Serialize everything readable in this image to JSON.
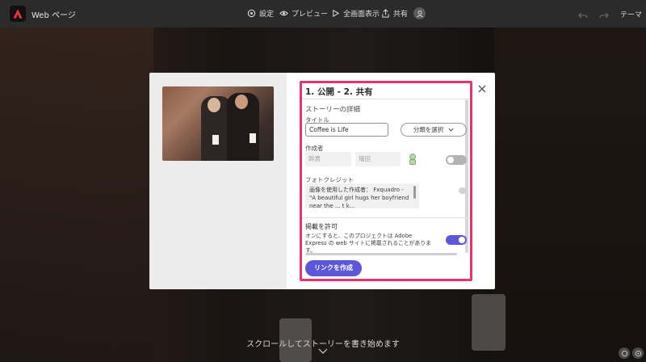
{
  "app": {
    "title": "Web ページ"
  },
  "toolbar": {
    "settings": "設定",
    "preview": "プレビュー",
    "fullscreen": "全画面表示",
    "share": "共有",
    "theme": "テーマ"
  },
  "modal": {
    "panel_title": "1. 公開 - 2. 共有",
    "story_details": "ストーリーの詳細",
    "title_label": "タイトル",
    "title_value": "Coffee is Life",
    "category_placeholder": "分類を選択",
    "author_label": "作成者",
    "first_name_placeholder": "幹男",
    "last_name_placeholder": "増田",
    "photo_credit_label": "フォトクレジット",
    "photo_credit_text": "画像を使用した作成者： Fxquadro - \"A beautiful girl hugs her boyfriend near the ... t k...",
    "allow_listing_label": "掲載を許可",
    "allow_listing_desc": "オンにすると、このプロジェクトは Adobe Express の web サイトに掲載されることがあります。",
    "allow_listing_on": true,
    "author_toggle_on": false,
    "create_link": "リンクを作成"
  },
  "page": {
    "scroll_hint": "スクロールしてストーリーを書き始めます"
  },
  "colors": {
    "accent": "#5b57d6",
    "highlight": "#e8336e"
  },
  "icons": [
    "adobe-logo-icon",
    "gear-icon",
    "eye-icon",
    "play-icon",
    "share-icon",
    "user-icon",
    "undo-icon",
    "redo-icon",
    "close-icon",
    "chevron-down-icon",
    "bot-icon"
  ]
}
